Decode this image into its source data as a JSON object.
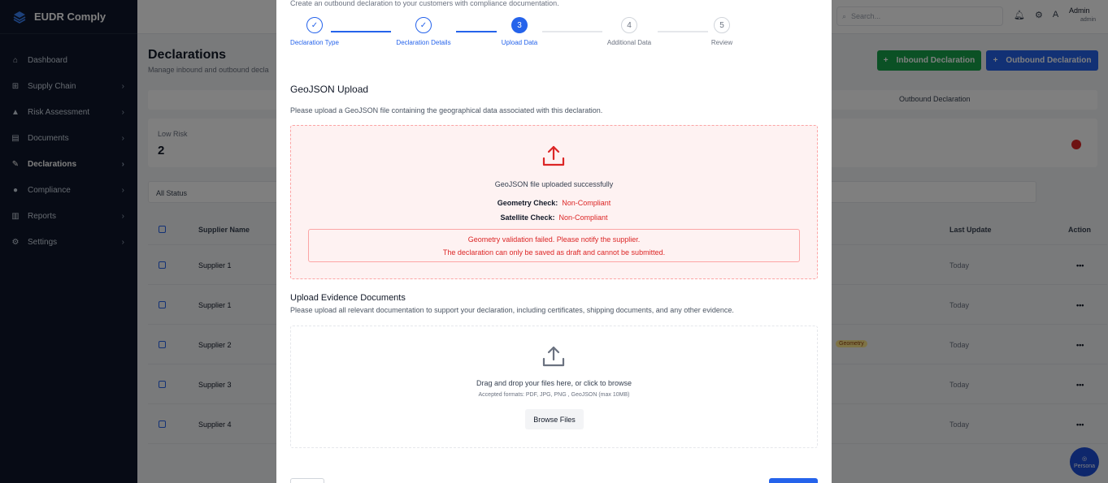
{
  "app": {
    "title": "EUDR Comply"
  },
  "sidebar": {
    "items": [
      {
        "label": "Dashboard",
        "icon": "home-icon",
        "chevron": false
      },
      {
        "label": "Supply Chain",
        "icon": "sitemap-icon",
        "chevron": true
      },
      {
        "label": "Risk Assessment",
        "icon": "warning-icon",
        "chevron": true
      },
      {
        "label": "Documents",
        "icon": "document-icon",
        "chevron": true
      },
      {
        "label": "Declarations",
        "icon": "edit-icon",
        "chevron": true,
        "active": true
      },
      {
        "label": "Compliance",
        "icon": "check-circle-icon",
        "chevron": true
      },
      {
        "label": "Reports",
        "icon": "chart-icon",
        "chevron": true
      },
      {
        "label": "Settings",
        "icon": "gear-icon",
        "chevron": true
      }
    ]
  },
  "topbar": {
    "search_placeholder": "Search...",
    "user_initial": "A",
    "user_name": "Admin",
    "user_role": "admin"
  },
  "page": {
    "title": "Declarations",
    "subtitle": "Manage inbound and outbound decla",
    "inbound_button": "Inbound Declaration",
    "outbound_button": "Outbound Declaration",
    "tab_outbound": "Outbound Declaration",
    "stat_label": "Low Risk",
    "stat_value": "2",
    "filter_value": "All Status",
    "table": {
      "headers": {
        "name": "Supplier Name",
        "last_update": "Last Update",
        "action": "Action"
      },
      "rows": [
        {
          "name": "Supplier 1",
          "last_update": "Today",
          "action": "•••"
        },
        {
          "name": "Supplier 1",
          "last_update": "Today",
          "action": "•••"
        },
        {
          "name": "Supplier 2",
          "last_update": "Today",
          "action": "•••",
          "badge": "Geometry"
        },
        {
          "name": "Supplier 3",
          "last_update": "Today",
          "action": "•••"
        },
        {
          "name": "Supplier 4",
          "last_update": "Today",
          "action": "•••"
        }
      ]
    },
    "persona_label": "Persona"
  },
  "modal": {
    "subtitle": "Create an outbound declaration to your customers with compliance documentation.",
    "steps": [
      {
        "label": "Declaration Type",
        "number": "✓",
        "state": "done"
      },
      {
        "label": "Declaration Details",
        "number": "✓",
        "state": "done"
      },
      {
        "label": "Upload Data",
        "number": "3",
        "state": "current"
      },
      {
        "label": "Additional Data",
        "number": "4",
        "state": "todo"
      },
      {
        "label": "Review",
        "number": "5",
        "state": "todo"
      }
    ],
    "geojson": {
      "title": "GeoJSON Upload",
      "description": "Please upload a GeoJSON file containing the geographical data associated with this declaration.",
      "success_text": "GeoJSON file uploaded successfully",
      "geometry_label": "Geometry Check:",
      "geometry_value": "Non-Compliant",
      "satellite_label": "Satellite Check:",
      "satellite_value": "Non-Compliant",
      "error_line1": "Geometry validation failed. Please notify the supplier.",
      "error_line2": "The declaration can only be saved as draft and cannot be submitted."
    },
    "evidence": {
      "title": "Upload Evidence Documents",
      "description": "Please upload all relevant documentation to support your declaration, including certificates, shipping documents, and any other evidence.",
      "drag_text": "Drag and drop your files here, or click to browse",
      "formats_text": "Accepted formats: PDF, JPG, PNG , GeoJSON (max 10MB)",
      "browse_button": "Browse Files"
    }
  },
  "colors": {
    "primary": "#2563eb",
    "error": "#dc2626",
    "error_bg": "#fef2f2",
    "success": "#16a34a",
    "sidebar_bg": "#0f172a"
  }
}
